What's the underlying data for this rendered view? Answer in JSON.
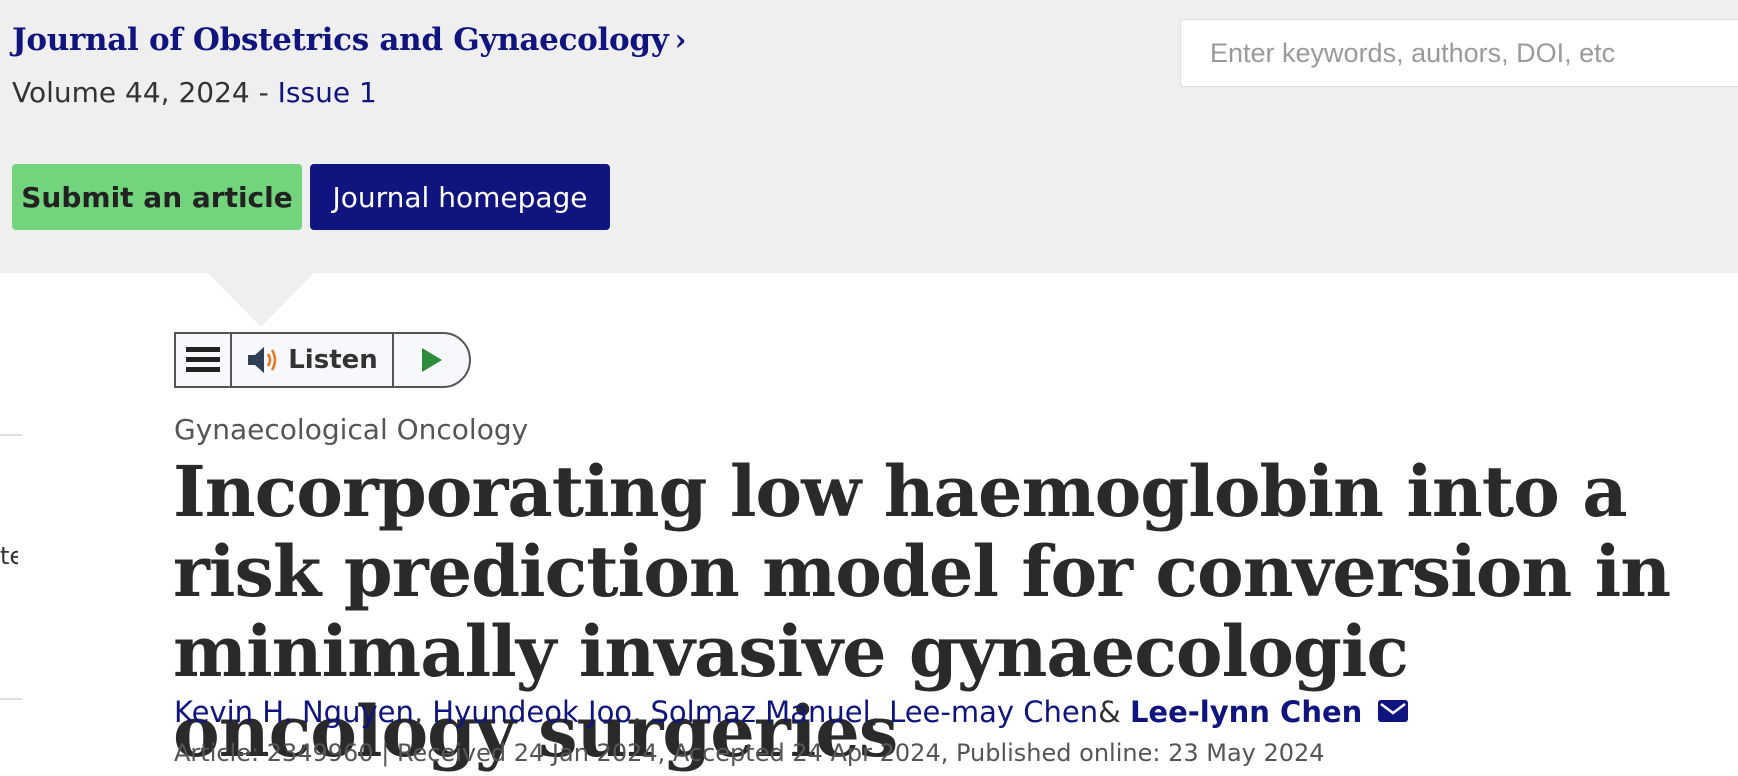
{
  "journal": {
    "name": "Journal of Obstetrics and Gynaecology",
    "chevron": "›",
    "volume": "Volume 44, 2024 - ",
    "issue": "Issue 1"
  },
  "search": {
    "placeholder": "Enter keywords, authors, DOI, etc"
  },
  "actions": {
    "submit_label": "Submit an article",
    "homepage_label": "Journal homepage"
  },
  "listen_widget": {
    "label": "Listen",
    "icons": [
      "menu-icon",
      "speaker-icon",
      "play-icon"
    ]
  },
  "sidebar": {
    "fragment": "te"
  },
  "article": {
    "category": "Gynaecological Oncology",
    "title": "Incorporating low haemoglobin into a risk prediction model for conversion in minimally invasive gynaecologic oncology surgeries",
    "authors": [
      {
        "name": "Kevin H. Nguyen",
        "sep": ","
      },
      {
        "name": "Hyundeok Joo",
        "sep": ","
      },
      {
        "name": "Solmaz Manuel",
        "sep": ","
      },
      {
        "name": "Lee-may Chen",
        "sep": " &"
      },
      {
        "name": "Lee-lynn Chen",
        "sep": ""
      }
    ],
    "meta": "Article: 2349960 | Received 24 Jan 2024, Accepted 24 Apr 2024, Published online: 23 May 2024"
  },
  "colors": {
    "brand_navy": "#10147e",
    "submit_green": "#72d47c",
    "header_bg": "#efeff0",
    "play_green": "#2e8b3a",
    "speaker_orange": "#e8761a"
  }
}
